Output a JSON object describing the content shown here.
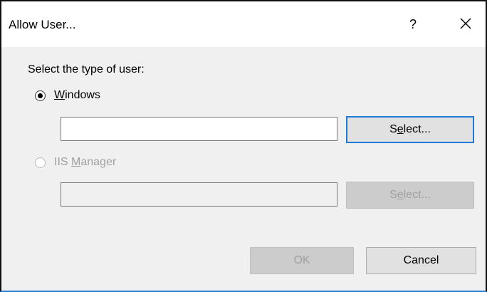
{
  "window": {
    "title": "Allow User...",
    "help_label": "?",
    "close_icon": "close-icon"
  },
  "form": {
    "prompt": "Select the type of user:",
    "windows_option": {
      "mnemonic": "W",
      "label_rest": "indows",
      "checked": true,
      "enabled": true,
      "input_value": "",
      "select_button": {
        "before": "S",
        "mnemonic": "e",
        "after": "lect..."
      }
    },
    "iis_option": {
      "label_before": "IIS ",
      "mnemonic": "M",
      "label_rest": "anager",
      "checked": false,
      "enabled": false,
      "input_value": "",
      "select_button": {
        "before": "S",
        "mnemonic": "e",
        "after": "lect..."
      }
    }
  },
  "buttons": {
    "ok": "OK",
    "cancel": "Cancel"
  },
  "colors": {
    "accent": "#1f7ad6",
    "client_background": "#f0f0f0",
    "disabled_text": "#a0a0a0"
  }
}
